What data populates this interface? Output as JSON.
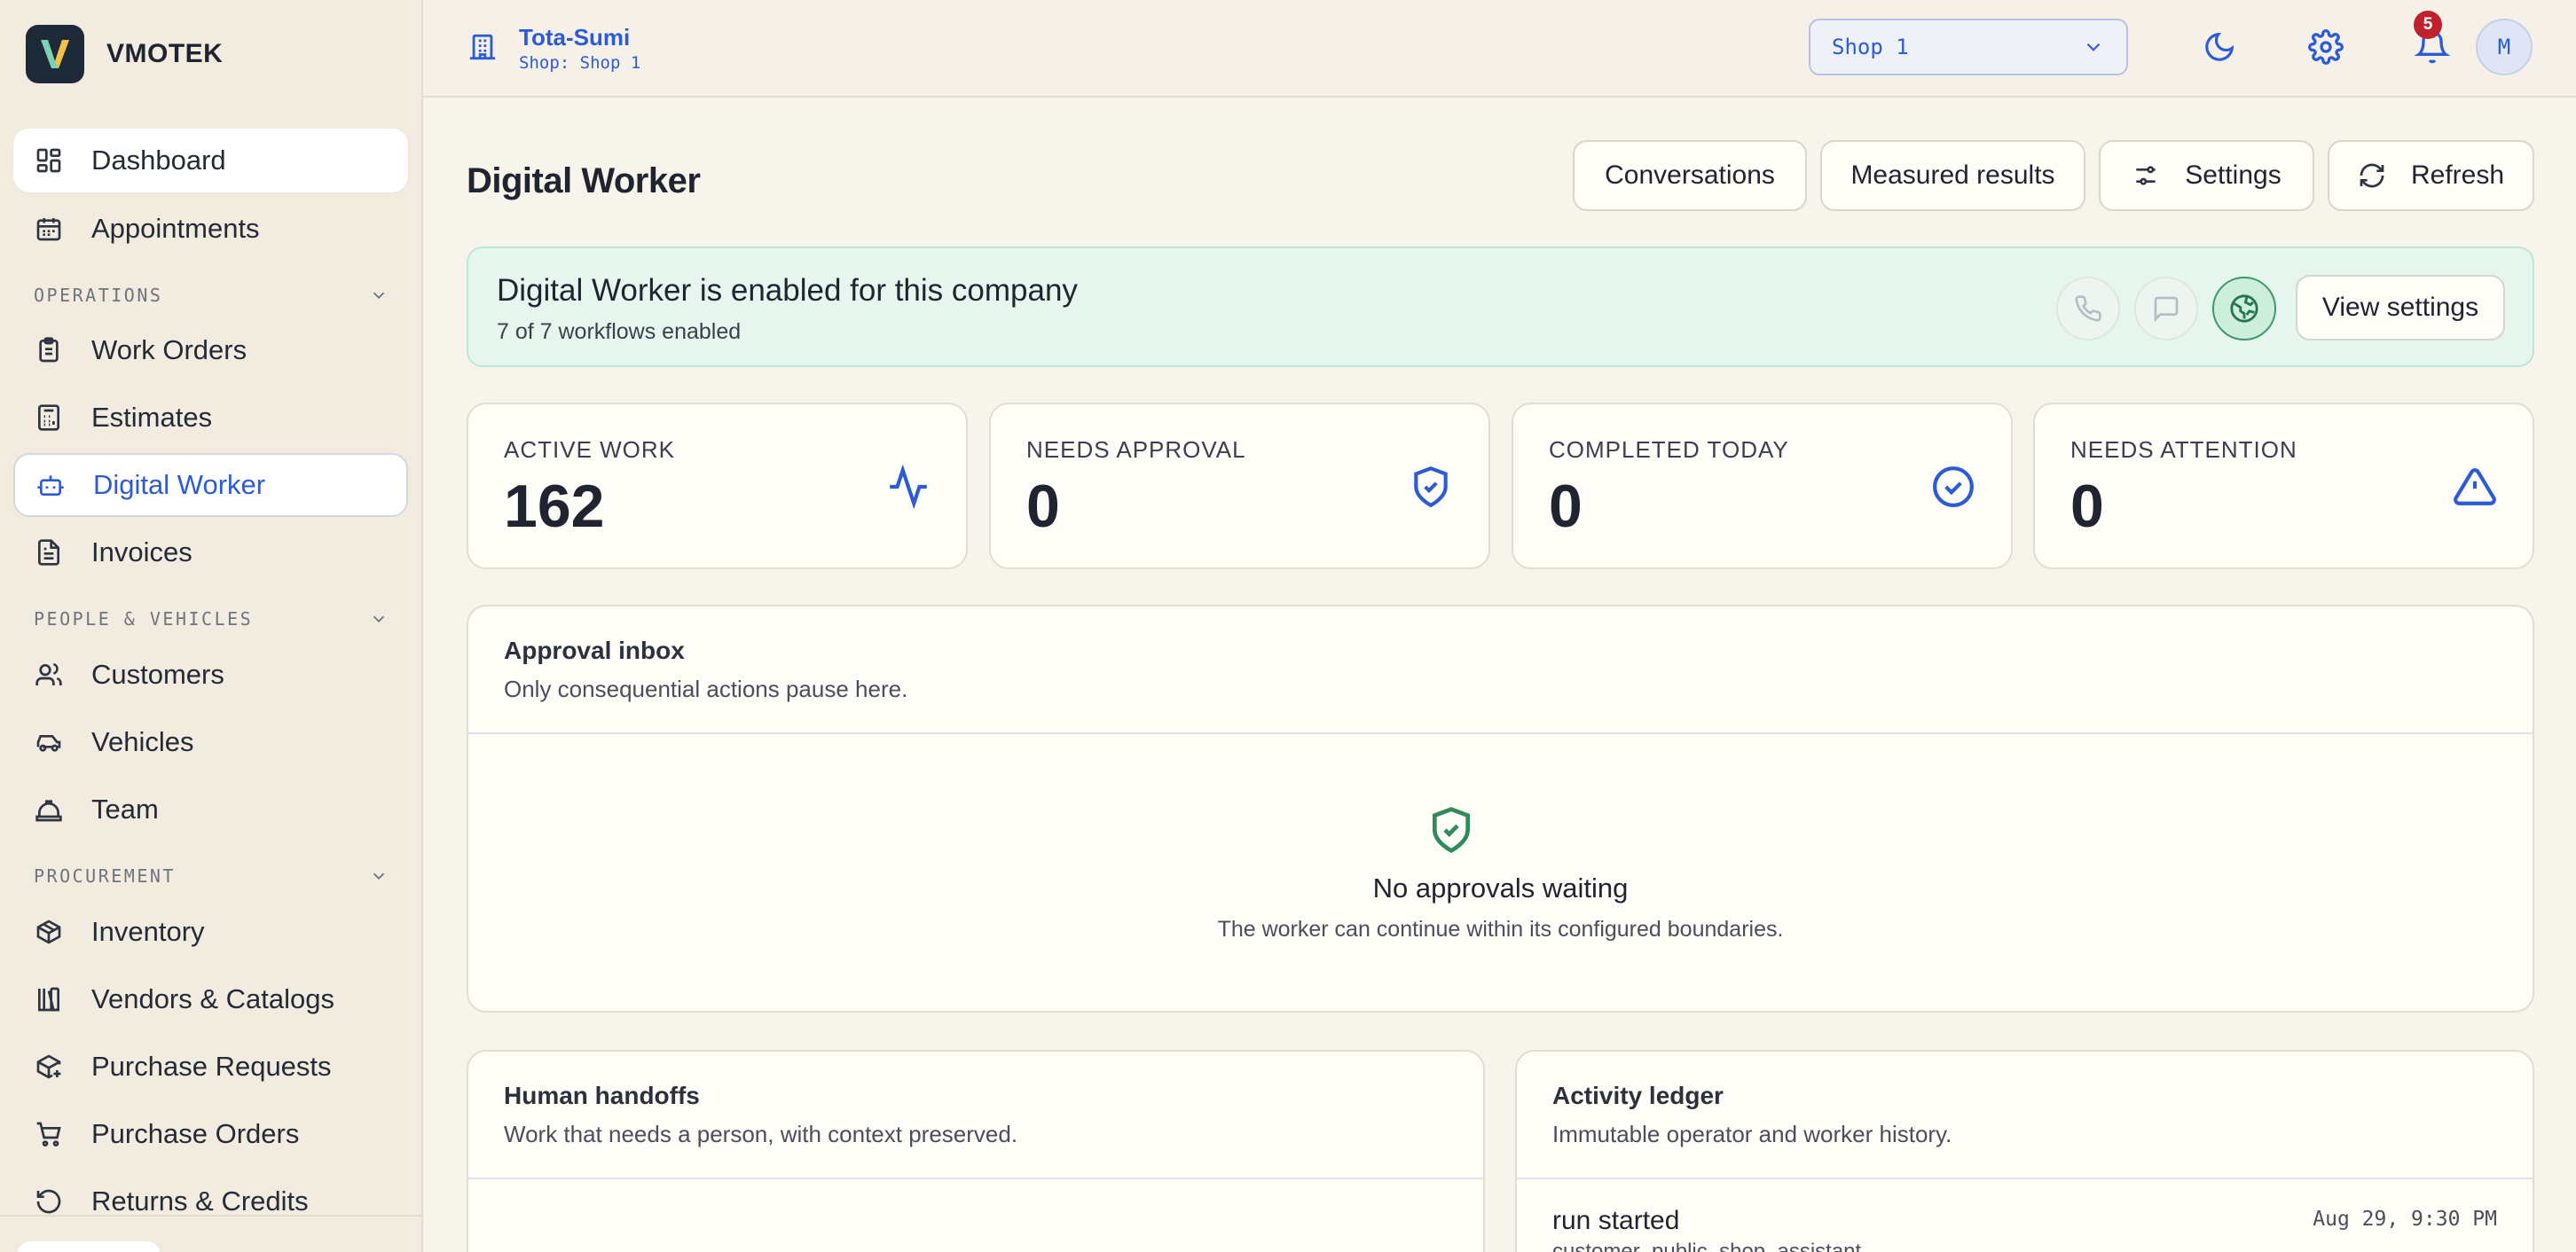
{
  "brand": {
    "name": "VMOTEK",
    "logo_letter": "V"
  },
  "sidebar": {
    "top_items": [
      {
        "label": "Dashboard",
        "icon": "dashboard-grid-icon"
      },
      {
        "label": "Appointments",
        "icon": "calendar-icon"
      }
    ],
    "sections": [
      {
        "label": "OPERATIONS",
        "items": [
          {
            "label": "Work Orders",
            "icon": "clipboard-icon"
          },
          {
            "label": "Estimates",
            "icon": "calculator-icon"
          },
          {
            "label": "Digital Worker",
            "icon": "bot-icon",
            "selected": true
          },
          {
            "label": "Invoices",
            "icon": "document-icon"
          }
        ]
      },
      {
        "label": "PEOPLE & VEHICLES",
        "items": [
          {
            "label": "Customers",
            "icon": "users-icon"
          },
          {
            "label": "Vehicles",
            "icon": "car-icon"
          },
          {
            "label": "Team",
            "icon": "hard-hat-icon"
          }
        ]
      },
      {
        "label": "PROCUREMENT",
        "items": [
          {
            "label": "Inventory",
            "icon": "package-icon"
          },
          {
            "label": "Vendors & Catalogs",
            "icon": "library-icon"
          },
          {
            "label": "Purchase Requests",
            "icon": "package-plus-icon"
          },
          {
            "label": "Purchase Orders",
            "icon": "cart-icon"
          },
          {
            "label": "Returns & Credits",
            "icon": "undo-icon"
          }
        ]
      }
    ]
  },
  "topbar": {
    "company_name": "Tota-Sumi",
    "company_shop": "Shop: Shop 1",
    "shop_select_value": "Shop 1",
    "notification_count": "5",
    "avatar_initial": "M"
  },
  "page": {
    "title": "Digital Worker",
    "actions": {
      "conversations": "Conversations",
      "measured_results": "Measured results",
      "settings": "Settings",
      "refresh": "Refresh"
    }
  },
  "banner": {
    "title": "Digital Worker is enabled for this company",
    "subtitle": "7 of 7 workflows enabled",
    "view_settings": "View settings"
  },
  "stats": [
    {
      "label": "ACTIVE WORK",
      "value": "162",
      "icon": "activity-icon"
    },
    {
      "label": "NEEDS APPROVAL",
      "value": "0",
      "icon": "shield-check-icon"
    },
    {
      "label": "COMPLETED TODAY",
      "value": "0",
      "icon": "check-circle-icon"
    },
    {
      "label": "NEEDS ATTENTION",
      "value": "0",
      "icon": "warning-triangle-icon"
    }
  ],
  "approval_inbox": {
    "title": "Approval inbox",
    "subtitle": "Only consequential actions pause here.",
    "empty_title": "No approvals waiting",
    "empty_subtitle": "The worker can continue within its configured boundaries."
  },
  "handoffs": {
    "title": "Human handoffs",
    "subtitle": "Work that needs a person, with context preserved."
  },
  "ledger": {
    "title": "Activity ledger",
    "subtitle": "Immutable operator and worker history.",
    "rows": [
      {
        "title": "run started",
        "meta": "customer_public_shop_assistant",
        "time": "Aug 29, 9:30 PM"
      }
    ]
  },
  "colors": {
    "accent": "#2b5bd7",
    "success": "#2f8a5c",
    "badge": "#c0212c",
    "banner_bg": "#e6f6ee"
  }
}
